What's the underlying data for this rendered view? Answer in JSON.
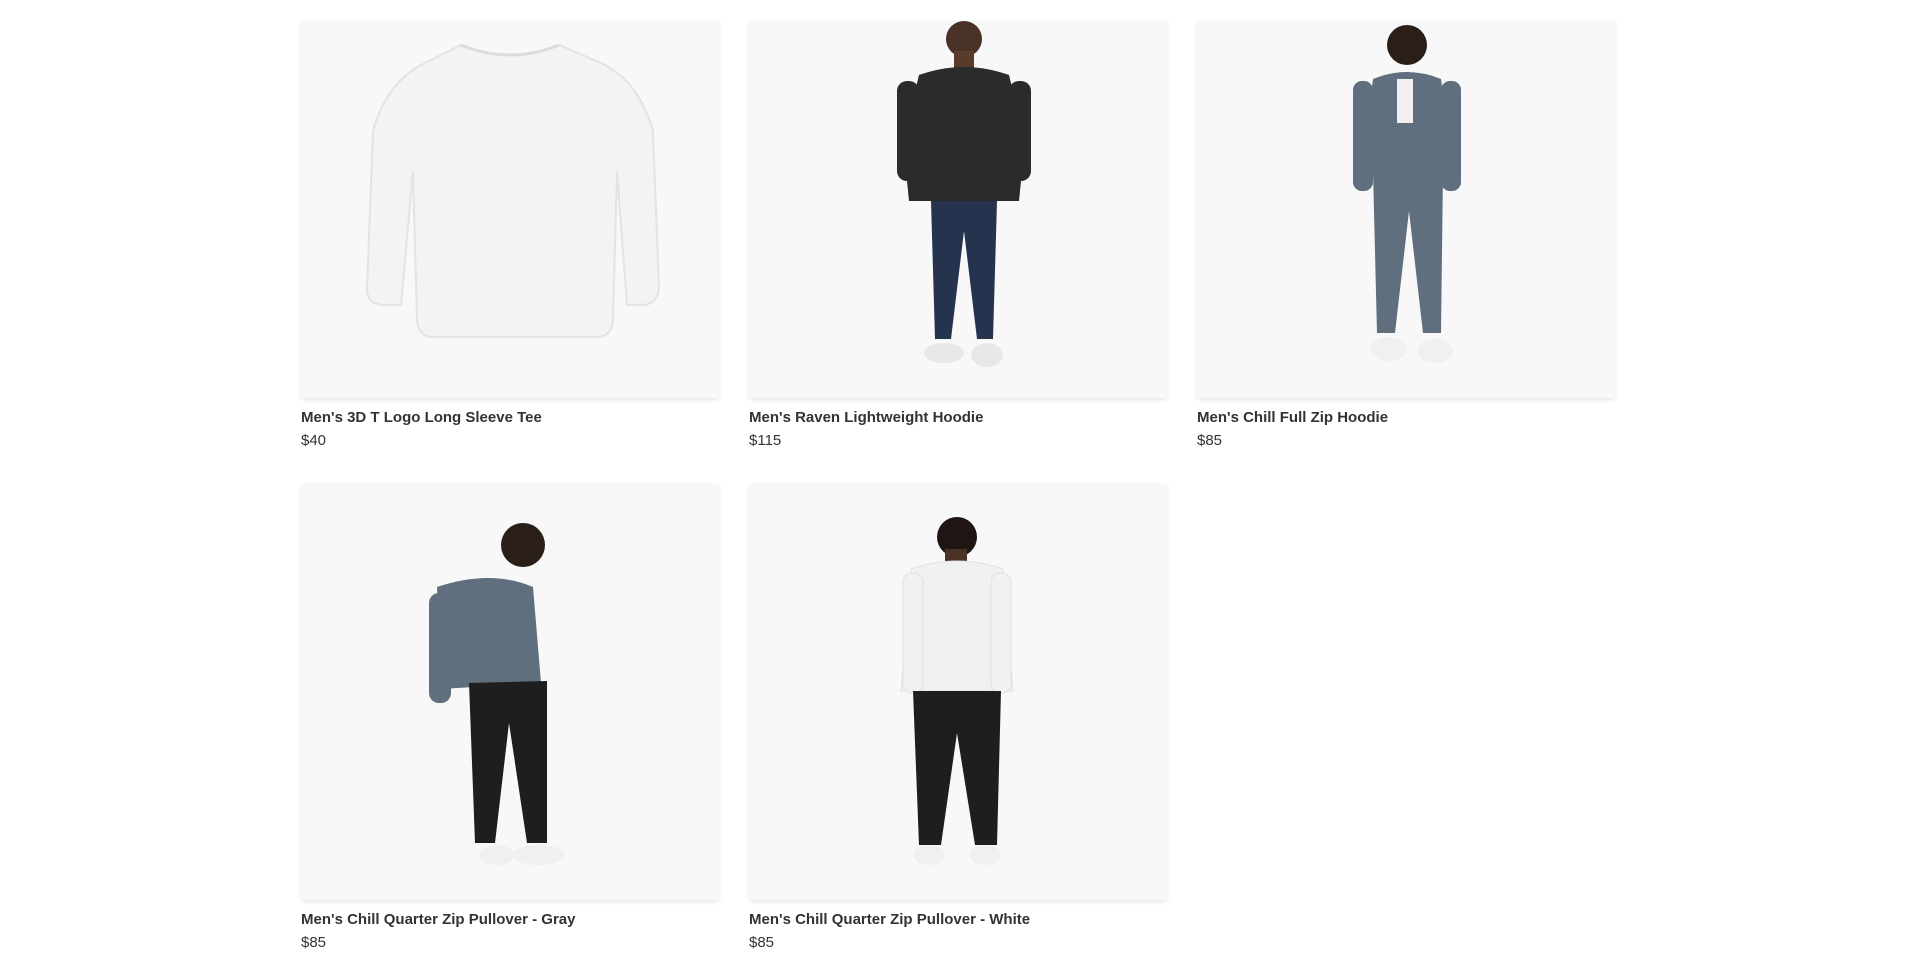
{
  "products": [
    {
      "title": "Men's 3D T Logo Long Sleeve Tee",
      "price": "$40",
      "image": "white-long-sleeve-tee-flat"
    },
    {
      "title": "Men's Raven Lightweight Hoodie",
      "price": "$115",
      "image": "model-black-hoodie-jeans"
    },
    {
      "title": "Men's Chill Full Zip Hoodie",
      "price": "$85",
      "image": "model-gray-zip-hoodie-joggers"
    },
    {
      "title": "Men's Chill Quarter Zip Pullover - Gray",
      "price": "$85",
      "image": "model-gray-quarter-zip"
    },
    {
      "title": "Men's Chill Quarter Zip Pullover - White",
      "price": "$85",
      "image": "model-white-quarter-zip-back"
    }
  ],
  "colors": {
    "card_bg": "#f8f8f8",
    "text": "#333333",
    "charcoal_garment": "#2b2b2b",
    "slate_garment": "#5f6f7d",
    "denim": "#26334f",
    "white_garment": "#f1f1f1"
  }
}
